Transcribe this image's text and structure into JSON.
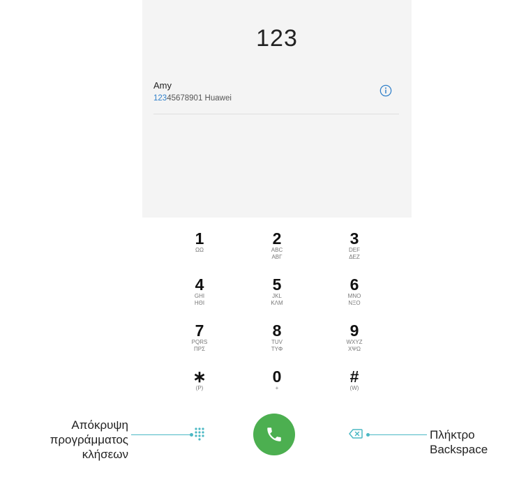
{
  "display": {
    "number": "123"
  },
  "suggestion": {
    "name": "Amy",
    "number_match": "123",
    "number_rest": "45678901 Huawei",
    "info_icon": "info-icon"
  },
  "keypad": [
    {
      "digit": "1",
      "l1": "ΩΩ",
      "l2": ""
    },
    {
      "digit": "2",
      "l1": "ABC",
      "l2": "ABΓ"
    },
    {
      "digit": "3",
      "l1": "DEF",
      "l2": "ΔEZ"
    },
    {
      "digit": "4",
      "l1": "GHI",
      "l2": "HΘI"
    },
    {
      "digit": "5",
      "l1": "JKL",
      "l2": "KΛM"
    },
    {
      "digit": "6",
      "l1": "MNO",
      "l2": "NΞΟ"
    },
    {
      "digit": "7",
      "l1": "PQRS",
      "l2": "ΠPΣ"
    },
    {
      "digit": "8",
      "l1": "TUV",
      "l2": "TYΦ"
    },
    {
      "digit": "9",
      "l1": "WXYZ",
      "l2": "XΨΩ"
    },
    {
      "digit": "∗",
      "l1": "(P)",
      "l2": ""
    },
    {
      "digit": "0",
      "l1": "+",
      "l2": ""
    },
    {
      "digit": "#",
      "l1": "(W)",
      "l2": ""
    }
  ],
  "bottom_bar": {
    "hide_dialpad_icon": "dialpad-icon",
    "call_icon": "phone-icon",
    "backspace_icon": "backspace-icon"
  },
  "callouts": {
    "left": [
      "Απόκρυψη",
      "προγράμματος",
      "κλήσεων"
    ],
    "right": [
      "Πλήκτρο",
      "Backspace"
    ]
  },
  "colors": {
    "call_button": "#4caf50",
    "highlight": "#2f7fc9",
    "leader_line": "#4bb8c4"
  }
}
